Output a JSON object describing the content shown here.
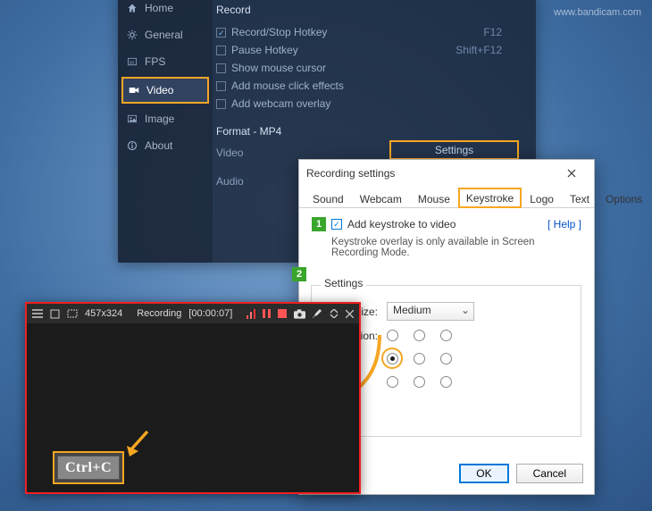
{
  "watermark": "www.bandicam.com",
  "bandicam": {
    "sidebar": [
      {
        "label": "Home"
      },
      {
        "label": "General"
      },
      {
        "label": "FPS"
      },
      {
        "label": "Video"
      },
      {
        "label": "Image"
      },
      {
        "label": "About"
      }
    ],
    "record_section": "Record",
    "options": {
      "record_hotkey": {
        "label": "Record/Stop Hotkey",
        "value": "F12",
        "checked": true
      },
      "pause_hotkey": {
        "label": "Pause Hotkey",
        "value": "Shift+F12",
        "checked": false
      },
      "show_mouse": {
        "label": "Show mouse cursor",
        "checked": false
      },
      "click_effects": {
        "label": "Add mouse click effects",
        "checked": false
      },
      "webcam_overlay": {
        "label": "Add webcam overlay",
        "checked": false
      }
    },
    "settings_button": "Settings",
    "format_section": "Format - MP4",
    "video_label": "Video",
    "audio_label": "Audio"
  },
  "dialog": {
    "title": "Recording settings",
    "tabs": [
      "Sound",
      "Webcam",
      "Mouse",
      "Keystroke",
      "Logo",
      "Text",
      "Options"
    ],
    "active_tab_index": 3,
    "step1": "1",
    "add_keystroke_label": "Add keystroke to video",
    "add_keystroke_checked": true,
    "help_label": "[ Help ]",
    "note": "Keystroke overlay is only available in Screen Recording Mode.",
    "step2": "2",
    "settings_group": "Settings",
    "font_size_label": "Font size:",
    "font_size_value": "Medium",
    "position_label": "Position:",
    "position_selected_index": 3,
    "ok": "OK",
    "cancel": "Cancel"
  },
  "recorder": {
    "resolution": "457x324",
    "status": "Recording",
    "elapsed": "[00:00:07]",
    "keystroke_text": "Ctrl+C"
  },
  "colors": {
    "highlight": "#f6a623",
    "step_green": "#39a62b",
    "record_red": "#f02020"
  }
}
